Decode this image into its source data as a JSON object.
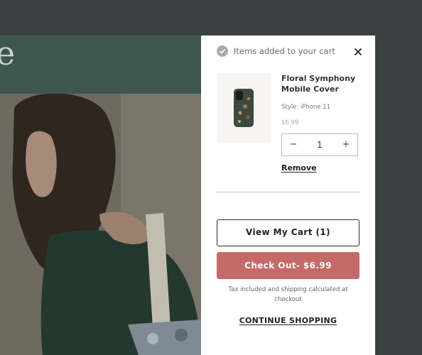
{
  "hero": {
    "heading_fragment": "e"
  },
  "cart_drawer": {
    "header_text": "Items added to your cart",
    "icons": {
      "status": "check-circle-icon",
      "close": "close-icon"
    },
    "item": {
      "title": "Floral Symphony Mobile Cover",
      "style": "Style: iPhone 11",
      "price": "$6.99",
      "quantity": "1",
      "decrement_label": "−",
      "increment_label": "+",
      "remove_label": "Remove"
    },
    "view_cart_label": "View My Cart (1)",
    "checkout_label": "Check Out- $6.99",
    "tax_note": "Tax included and shipping calculated at checkout",
    "continue_label": "CONTINUE SHOPPING"
  },
  "colors": {
    "backdrop": "#3b4342",
    "hero_band": "#3d574f",
    "checkout_accent": "#c56a68",
    "drawer_bg": "#ffffff"
  }
}
